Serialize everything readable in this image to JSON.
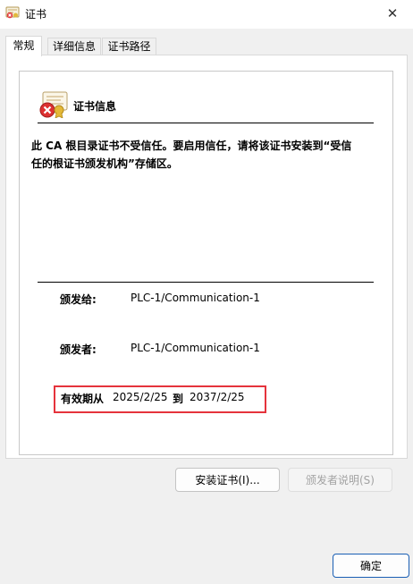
{
  "window": {
    "title": "证书",
    "close_glyph": "✕"
  },
  "tabs": [
    {
      "label": "常规",
      "active": true
    },
    {
      "label": "详细信息",
      "active": false
    },
    {
      "label": "证书路径",
      "active": false
    }
  ],
  "cert": {
    "info_title": "证书信息",
    "warning_line1": "此 CA 根目录证书不受信任。要启用信任，请将该证书安装到“受信",
    "warning_line2": "任的根证书颁发机构”存储区。",
    "issued_to_label": "颁发给:",
    "issued_to_value": "PLC-1/Communication-1",
    "issued_by_label": "颁发者:",
    "issued_by_value": "PLC-1/Communication-1",
    "valid_from_label": "有效期从",
    "valid_from": "2025/2/25",
    "valid_to_label": "到",
    "valid_to": "2037/2/25"
  },
  "buttons": {
    "install": "安装证书(I)...",
    "issuer_statement": "颁发者说明(S)",
    "ok": "确定"
  },
  "colors": {
    "highlight": "#e5333c",
    "accent": "#1a5fb4"
  },
  "icons": {
    "app": "certificate-icon",
    "cert": "certificate-error-icon",
    "close": "close-icon"
  }
}
